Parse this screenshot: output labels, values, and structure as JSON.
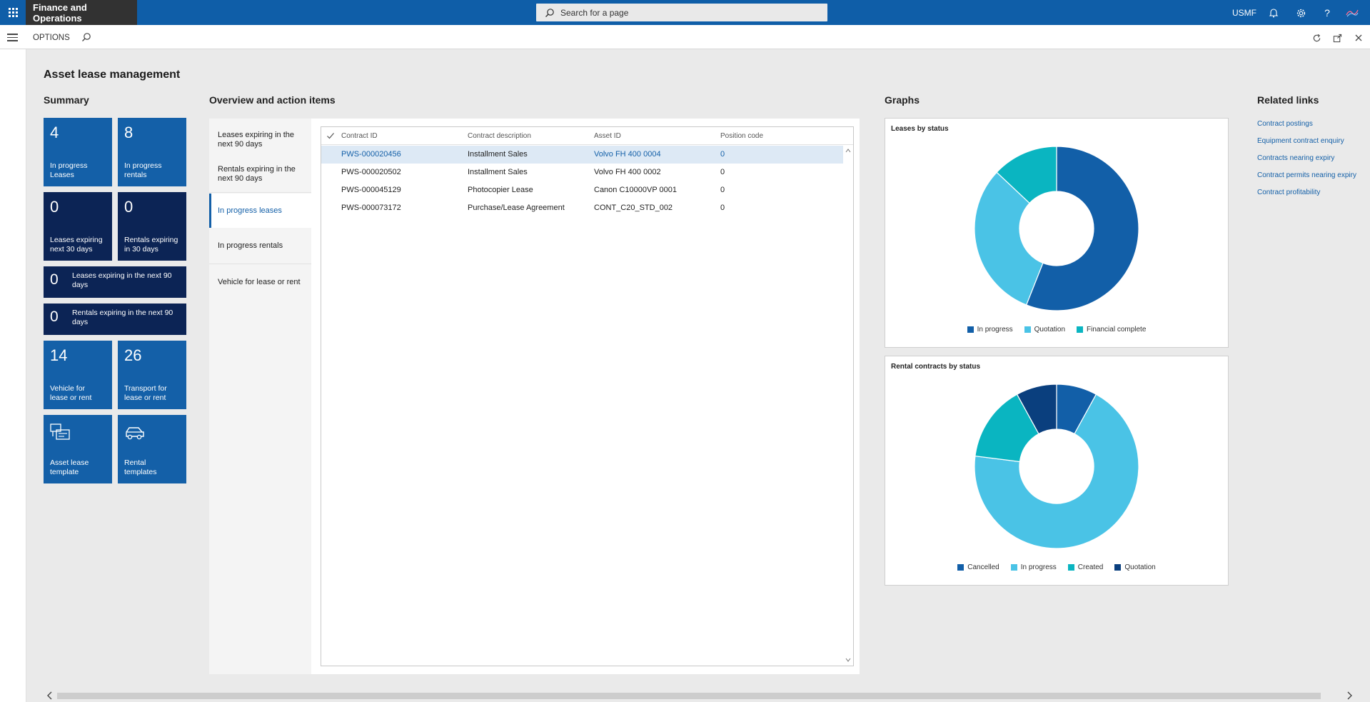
{
  "header": {
    "app_title": "Finance and Operations",
    "search_placeholder": "Search for a page",
    "company": "USMF"
  },
  "actionbar": {
    "options_label": "OPTIONS"
  },
  "page": {
    "title": "Asset lease management"
  },
  "summary": {
    "title": "Summary",
    "tiles": [
      {
        "value": "4",
        "label": "In progress\nLeases"
      },
      {
        "value": "8",
        "label": "In progress\nrentals"
      },
      {
        "value": "0",
        "label": "Leases expiring\nnext 30 days"
      },
      {
        "value": "0",
        "label": "Rentals expiring\nin 30 days"
      },
      {
        "value": "0",
        "label": "Leases expiring in the next 90 days"
      },
      {
        "value": "0",
        "label": "Rentals expiring in the next 90 days"
      },
      {
        "value": "14",
        "label": "Vehicle for\nlease or rent"
      },
      {
        "value": "26",
        "label": "Transport for\nlease or rent"
      },
      {
        "label": "Asset lease\ntemplate",
        "icon": "template-icon"
      },
      {
        "label": "Rental\ntemplates",
        "icon": "car-icon"
      }
    ]
  },
  "overview": {
    "title": "Overview and action items",
    "tabs": [
      "Leases expiring in the next 90 days",
      "Rentals expiring in the next 90 days",
      "In progress leases",
      "In progress rentals",
      "Vehicle for lease or rent"
    ],
    "active_tab": "In progress leases",
    "columns": [
      "Contract ID",
      "Contract description",
      "Asset ID",
      "Position code"
    ],
    "rows": [
      {
        "contract_id": "PWS-000020456",
        "description": "Installment Sales",
        "asset_id": "Volvo FH 400 0004",
        "position": "0"
      },
      {
        "contract_id": "PWS-000020502",
        "description": "Installment Sales",
        "asset_id": "Volvo FH 400 0002",
        "position": "0"
      },
      {
        "contract_id": "PWS-000045129",
        "description": "Photocopier Lease",
        "asset_id": "Canon C10000VP 0001",
        "position": "0"
      },
      {
        "contract_id": "PWS-000073172",
        "description": "Purchase/Lease Agreement",
        "asset_id": "CONT_C20_STD_002",
        "position": "0"
      }
    ]
  },
  "graphs": {
    "title": "Graphs",
    "leases_by_status": {
      "title": "Leases by status",
      "legend": [
        "In progress",
        "Quotation",
        "Financial complete"
      ]
    },
    "rentals_by_status": {
      "title": "Rental contracts by status",
      "legend": [
        "Cancelled",
        "In progress",
        "Created",
        "Quotation"
      ]
    }
  },
  "chart_data": [
    {
      "type": "pie",
      "title": "Leases by status",
      "categories": [
        "In progress",
        "Quotation",
        "Financial complete"
      ],
      "values": [
        56,
        31,
        13
      ],
      "colors": [
        "#125fa8",
        "#4ac3e6",
        "#0ab5c1"
      ],
      "legend": "bottom"
    },
    {
      "type": "pie",
      "title": "Rental contracts by status",
      "categories": [
        "Cancelled",
        "In progress",
        "Created",
        "Quotation"
      ],
      "values": [
        8,
        69,
        15,
        8
      ],
      "colors": [
        "#125fa8",
        "#4ac3e6",
        "#0ab5c1",
        "#0a3f7e"
      ],
      "legend": "bottom"
    }
  ],
  "related_links": {
    "title": "Related links",
    "items": [
      "Contract postings",
      "Equipment contract enquiry",
      "Contracts nearing expiry",
      "Contract permits nearing expiry",
      "Contract profitability"
    ]
  },
  "colors": {
    "brand_blue": "#0f5ea8",
    "tile_blue": "#1460a8",
    "tile_dark": "#0c2455",
    "link": "#1460a8"
  }
}
